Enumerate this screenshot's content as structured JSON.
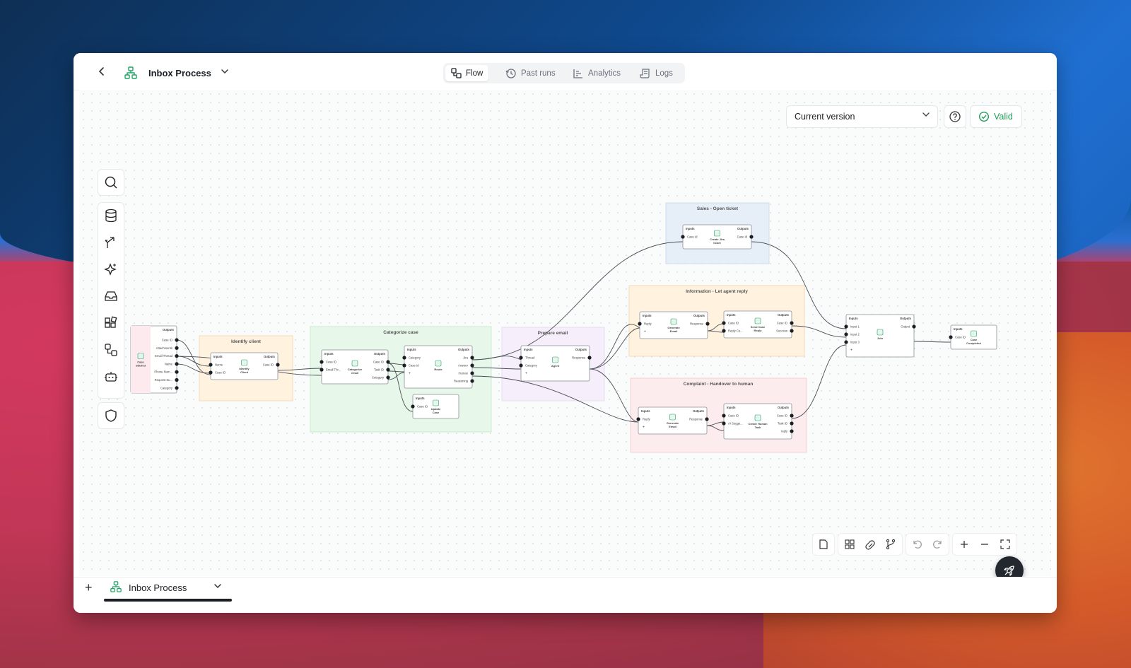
{
  "header": {
    "title": "Inbox Process",
    "tabs": [
      {
        "label": "Flow",
        "icon": "flow-icon",
        "active": true
      },
      {
        "label": "Past runs",
        "icon": "history-icon",
        "active": false
      },
      {
        "label": "Analytics",
        "icon": "chart-icon",
        "active": false
      },
      {
        "label": "Logs",
        "icon": "scroll-icon",
        "active": false
      }
    ]
  },
  "toolbar_right": {
    "version_select": "Current version",
    "status": "Valid"
  },
  "groups": {
    "identify": "Identify client",
    "categorize": "Categorize case",
    "prepare": "Prepare email",
    "sales": "Sales - Open ticket",
    "information": "Information - Let agent reply",
    "complaint": "Complaint - Handover to human"
  },
  "nodes": {
    "case_started": {
      "title": "Case Started",
      "outputs_label": "Outputs",
      "outputs": [
        "Case ID",
        "Attachments",
        "Email Thread",
        "Name",
        "Phone Num...",
        "Request Su...",
        "Category"
      ]
    },
    "identify_client": {
      "title": "Identify Client",
      "inputs_label": "Inputs",
      "outputs_label": "Outputs",
      "inputs": [
        "Name",
        "Case ID"
      ],
      "outputs": [
        "Case ID"
      ]
    },
    "categorize_email": {
      "title": "Categorize email",
      "inputs_label": "Inputs",
      "outputs_label": "Outputs",
      "inputs": [
        "Case ID",
        "Email Thr..."
      ],
      "outputs": [
        "Case ID",
        "Task ID",
        "Category"
      ]
    },
    "route": {
      "title": "Route",
      "inputs_label": "Inputs",
      "outputs_label": "Outputs",
      "inputs": [
        "Category",
        "Case Id",
        "+"
      ],
      "outputs": [
        "Jira",
        "Answer",
        "Human",
        "Reasoning"
      ]
    },
    "update_case": {
      "title": "Update Case",
      "inputs_label": "Inputs",
      "inputs": [
        "Case ID"
      ]
    },
    "agent": {
      "title": "Agent",
      "inputs_label": "Inputs",
      "outputs_label": "Outputs",
      "inputs": [
        "Thread",
        "Category",
        "+"
      ],
      "outputs": [
        "Response"
      ]
    },
    "create_jira": {
      "title": "Create Jira ticket",
      "inputs_label": "Inputs",
      "outputs_label": "Outputs",
      "inputs": [
        "Case Id"
      ],
      "outputs": [
        "Case Id"
      ]
    },
    "generate_email_1": {
      "title": "Generate Email",
      "inputs_label": "Inputs",
      "outputs_label": "Outputs",
      "inputs": [
        "Reply",
        "+"
      ],
      "outputs": [
        "Response"
      ]
    },
    "send_case_reply": {
      "title": "Send Case Reply",
      "inputs_label": "Inputs",
      "outputs_label": "Outputs",
      "inputs": [
        "Case ID",
        "Reply Co..."
      ],
      "outputs": [
        "Case ID",
        "Success"
      ]
    },
    "generate_email_2": {
      "title": "Generate Email",
      "inputs_label": "Inputs",
      "outputs_label": "Outputs",
      "inputs": [
        "Reply",
        "+"
      ],
      "outputs": [
        "Response"
      ]
    },
    "create_human_task": {
      "title": "Create Human Task",
      "inputs_label": "Inputs",
      "outputs_label": "Outputs",
      "inputs": [
        "Case ID",
        "AI Sugge..."
      ],
      "outputs": [
        "Case ID",
        "Task ID",
        "reply"
      ]
    },
    "join": {
      "title": "Join",
      "inputs_label": "Inputs",
      "outputs_label": "Outputs",
      "inputs": [
        "Input 1",
        "Input 2",
        "Input 3",
        "+"
      ],
      "outputs": [
        "Output"
      ]
    },
    "case_completed": {
      "title": "Case Completed",
      "inputs_label": "Inputs",
      "inputs": [
        "Case ID"
      ]
    }
  },
  "footer": {
    "tab_title": "Inbox Process"
  },
  "colors": {
    "valid": "#1f9d55",
    "accent_green": "#1fa463"
  }
}
